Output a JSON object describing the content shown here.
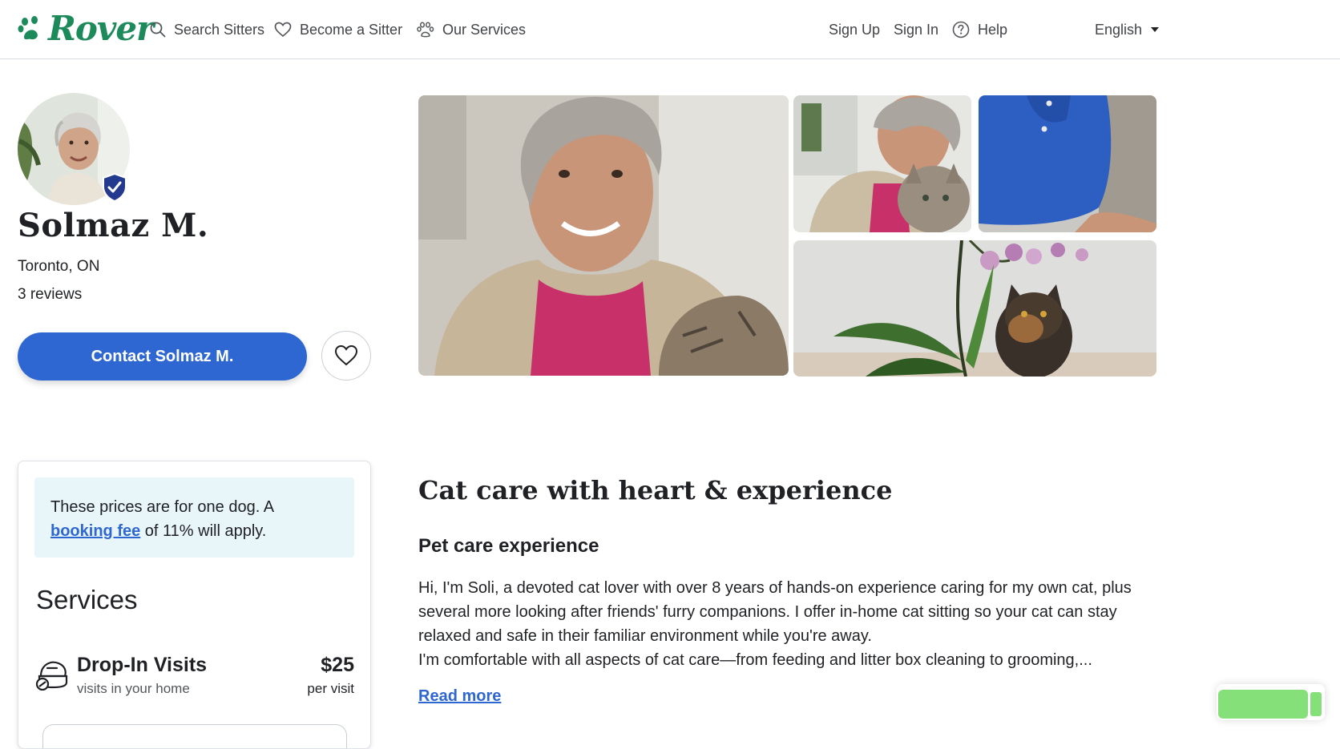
{
  "header": {
    "logo_text": "Rover",
    "nav": {
      "search_sitters": "Search Sitters",
      "become_sitter": "Become a Sitter",
      "our_services": "Our Services",
      "sign_up": "Sign Up",
      "sign_in": "Sign In",
      "help": "Help",
      "language": "English"
    }
  },
  "profile": {
    "name": "Solmaz M.",
    "location": "Toronto, ON",
    "reviews": "3 reviews",
    "contact_button": "Contact Solmaz M."
  },
  "pricing": {
    "notice_prefix": "These prices are for one dog. A",
    "notice_link": "booking fee",
    "notice_suffix": "of 11% will apply.",
    "services_title": "Services",
    "services": [
      {
        "name": "Drop-In Visits",
        "subtitle": "visits in your home",
        "price": "$25",
        "unit": "per visit"
      }
    ]
  },
  "about": {
    "heading": "Cat care with heart & experience",
    "subheading": "Pet care experience",
    "paragraph_1": "Hi, I'm Soli, a devoted cat lover with over 8 years of hands-on experience caring for my own cat, plus several more looking after friends' furry companions. I offer in-home cat sitting so your cat can stay relaxed and safe in their familiar environment while you're away.",
    "paragraph_2": "I'm comfortable with all aspects of cat care—from feeding and litter box cleaning to grooming,...",
    "read_more": "Read more"
  },
  "colors": {
    "brand_green": "#1c8a5a",
    "primary_blue": "#2e67d1",
    "notice_bg": "#e9f6f9"
  }
}
